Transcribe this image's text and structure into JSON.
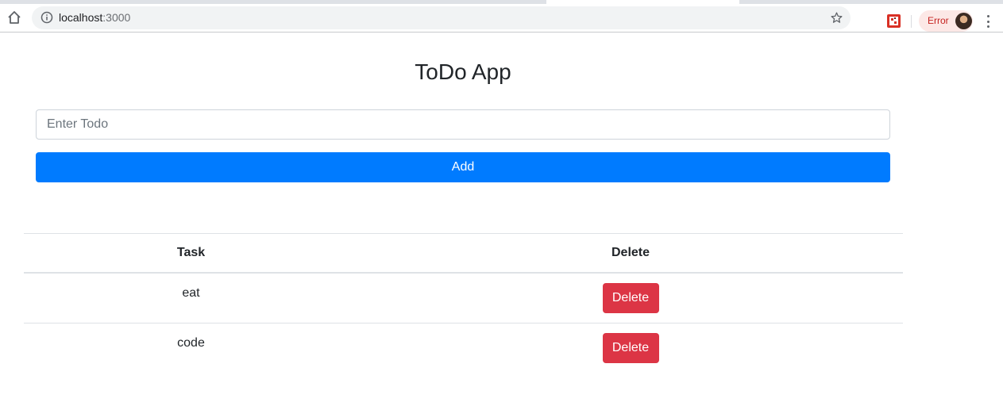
{
  "browser": {
    "url_host": "localhost",
    "url_port": ":3000",
    "error_label": "Error"
  },
  "app": {
    "title": "ToDo App",
    "input": {
      "placeholder": "Enter Todo",
      "value": ""
    },
    "add_button_label": "Add"
  },
  "table": {
    "headers": {
      "task": "Task",
      "delete": "Delete"
    },
    "rows": [
      {
        "task": "eat",
        "delete_label": "Delete"
      },
      {
        "task": "code",
        "delete_label": "Delete"
      }
    ]
  },
  "colors": {
    "primary": "#007bff",
    "danger": "#dc3545"
  }
}
